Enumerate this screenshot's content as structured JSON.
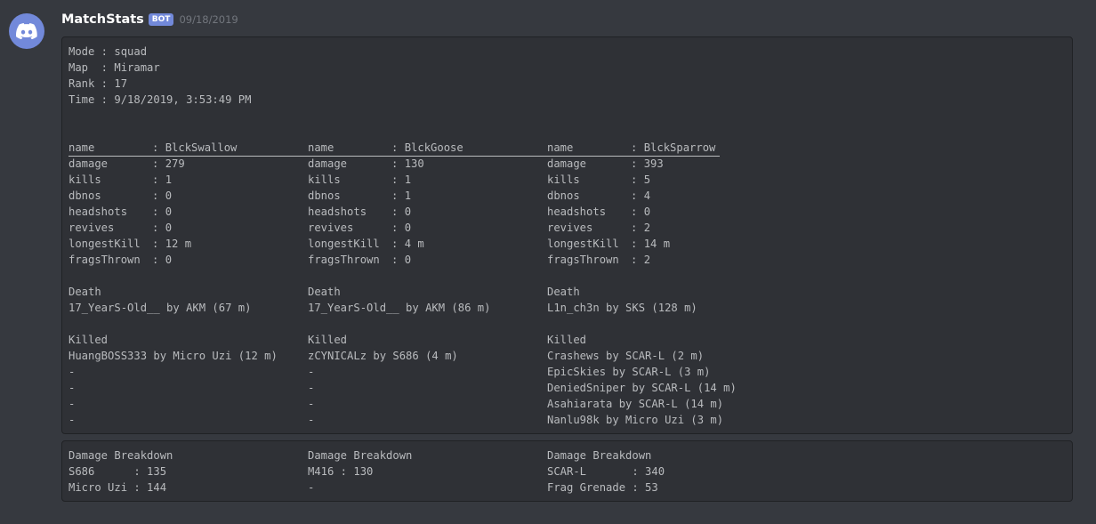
{
  "message": {
    "username": "MatchStats",
    "bot_tag": "BOT",
    "timestamp": "09/18/2019"
  },
  "match": {
    "mode_label": "Mode : squad",
    "map_label": "Map  : Miramar",
    "rank_label": "Rank : 17",
    "time_label": "Time : 9/18/2019, 3:53:49 PM"
  },
  "stat_labels": {
    "name": "name",
    "damage": "damage",
    "kills": "kills",
    "dbnos": "dbnos",
    "headshots": "headshots",
    "revives": "revives",
    "longestKill": "longestKill",
    "fragsThrown": "fragsThrown",
    "separator": ": "
  },
  "section_labels": {
    "death": "Death",
    "killed": "Killed",
    "damage_breakdown": "Damage Breakdown"
  },
  "players": [
    {
      "name": "BlckSwallow",
      "damage": "279",
      "kills": "1",
      "dbnos": "0",
      "headshots": "0",
      "revives": "0",
      "longestKill": "12 m",
      "fragsThrown": "0",
      "death": "17_YearS-Old__ by AKM (67 m)",
      "killed": [
        "HuangBOSS333 by Micro Uzi (12 m)",
        "-",
        "-",
        "-",
        "-"
      ],
      "damage_breakdown": [
        "S686      : 135",
        "Micro Uzi : 144",
        ""
      ]
    },
    {
      "name": "BlckGoose",
      "damage": "130",
      "kills": "1",
      "dbnos": "1",
      "headshots": "0",
      "revives": "0",
      "longestKill": "4 m",
      "fragsThrown": "0",
      "death": "17_YearS-Old__ by AKM (86 m)",
      "killed": [
        "zCYNICALz by S686 (4 m)",
        "-",
        "-",
        "-",
        "-"
      ],
      "damage_breakdown": [
        "M416 : 130",
        "-",
        ""
      ]
    },
    {
      "name": "BlckSparrow",
      "damage": "393",
      "kills": "5",
      "dbnos": "4",
      "headshots": "0",
      "revives": "2",
      "longestKill": "14 m",
      "fragsThrown": "2",
      "death": "L1n_ch3n by SKS (128 m)",
      "killed": [
        "Crashews by SCAR-L (2 m)",
        "EpicSkies by SCAR-L (3 m)",
        "DeniedSniper by SCAR-L (14 m)",
        "Asahiarata by SCAR-L (14 m)",
        "Nanlu98k by Micro Uzi (3 m)"
      ],
      "damage_breakdown": [
        "SCAR-L       : 340",
        "Frag Grenade : 53",
        ""
      ]
    }
  ],
  "icons": {
    "avatar": "discord-logo-icon"
  },
  "colors": {
    "background": "#36393f",
    "codeblock": "#2f3136",
    "accent": "#7289da"
  }
}
